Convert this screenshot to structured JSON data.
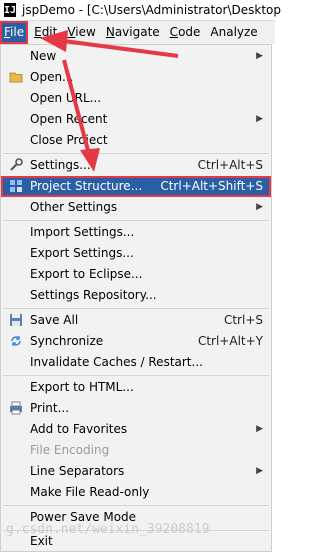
{
  "window": {
    "title": "jspDemo - [C:\\Users\\Administrator\\Desktop"
  },
  "menubar": [
    {
      "label": "File",
      "ul": "F",
      "rest": "ile"
    },
    {
      "label": "Edit",
      "ul": "E",
      "rest": "dit"
    },
    {
      "label": "View",
      "ul": "V",
      "rest": "iew"
    },
    {
      "label": "Navigate",
      "ul": "N",
      "rest": "avigate"
    },
    {
      "label": "Code",
      "ul": "C",
      "rest": "ode"
    },
    {
      "label": "Analyze",
      "ul": "",
      "rest": "Analyze"
    }
  ],
  "file_menu": {
    "new": {
      "label": "New"
    },
    "open": {
      "label": "Open..."
    },
    "open_url": {
      "label": "Open URL..."
    },
    "open_recent": {
      "label": "Open Recent"
    },
    "close_project": {
      "label": "Close Project"
    },
    "settings": {
      "label": "Settings...",
      "shortcut": "Ctrl+Alt+S"
    },
    "project_structure": {
      "label": "Project Structure...",
      "shortcut": "Ctrl+Alt+Shift+S"
    },
    "other_settings": {
      "label": "Other Settings"
    },
    "import_settings": {
      "label": "Import Settings..."
    },
    "export_settings": {
      "label": "Export Settings..."
    },
    "export_eclipse": {
      "label": "Export to Eclipse..."
    },
    "settings_repo": {
      "label": "Settings Repository..."
    },
    "save_all": {
      "label": "Save All",
      "shortcut": "Ctrl+S"
    },
    "synchronize": {
      "label": "Synchronize",
      "shortcut": "Ctrl+Alt+Y"
    },
    "invalidate": {
      "label": "Invalidate Caches / Restart..."
    },
    "export_html": {
      "label": "Export to HTML..."
    },
    "print": {
      "label": "Print..."
    },
    "favorites": {
      "label": "Add to Favorites"
    },
    "file_encoding": {
      "label": "File Encoding"
    },
    "line_separators": {
      "label": "Line Separators"
    },
    "read_only": {
      "label": "Make File Read-only"
    },
    "power_save": {
      "label": "Power Save Mode"
    },
    "exit": {
      "label": "Exit"
    }
  },
  "watermark": "g.csdn.net/weixin_39208819",
  "colors": {
    "highlight": "#2a5fa6",
    "annotation": "#e53946"
  }
}
